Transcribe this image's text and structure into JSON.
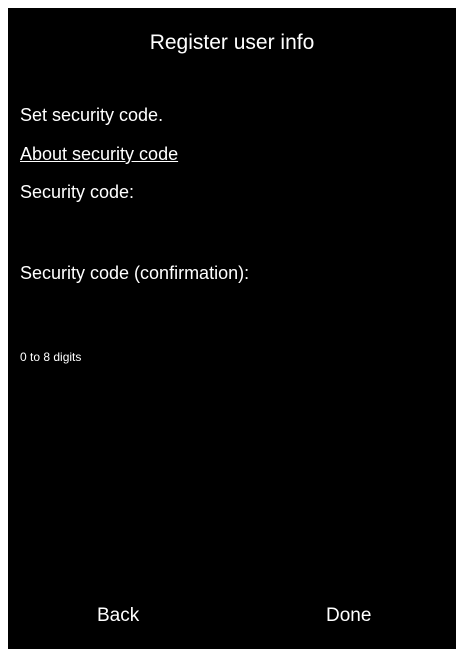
{
  "header": {
    "title": "Register user info"
  },
  "body": {
    "instruction": "Set security code.",
    "about_link": "About security code",
    "code_label": "Security code:",
    "code_value": "",
    "confirm_label": "Security code (confirmation):",
    "confirm_value": "",
    "hint": "0 to 8 digits"
  },
  "footer": {
    "back_label": "Back",
    "done_label": "Done"
  },
  "colors": {
    "background": "#000000",
    "text": "#ffffff",
    "frame": "#ffffff"
  }
}
